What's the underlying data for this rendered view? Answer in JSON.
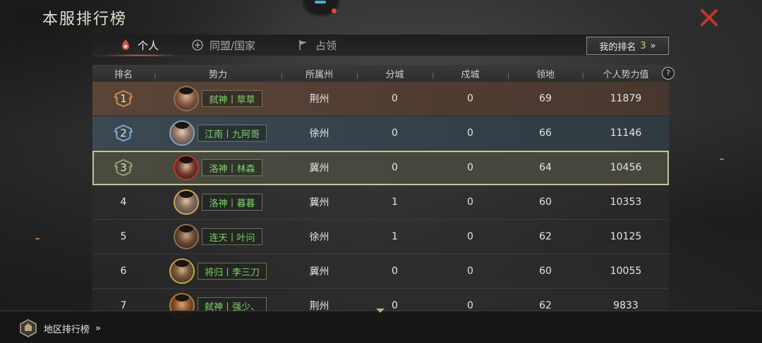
{
  "header": {
    "title": "本服排行榜"
  },
  "tabs": [
    {
      "label": "个人",
      "active": true,
      "icon": "person-flame-icon"
    },
    {
      "label": "同盟/国家",
      "active": false,
      "icon": "alliance-emblem-icon"
    },
    {
      "label": "占领",
      "active": false,
      "icon": "flag-icon"
    }
  ],
  "my_rank": {
    "label": "我的排名",
    "value": "3",
    "arrow": "»"
  },
  "columns": [
    "排名",
    "势力",
    "所属州",
    "分城",
    "戍城",
    "领地",
    "个人势力值"
  ],
  "help_icon": "?",
  "rows": [
    {
      "rank": "1",
      "force": "弑神丨草草",
      "province": "荆州",
      "branch_cities": "0",
      "garrisons": "0",
      "territory": "69",
      "power": "11879"
    },
    {
      "rank": "2",
      "force": "江南丨九阿哥",
      "province": "徐州",
      "branch_cities": "0",
      "garrisons": "0",
      "territory": "66",
      "power": "11146"
    },
    {
      "rank": "3",
      "force": "洛神丨林森",
      "province": "冀州",
      "branch_cities": "0",
      "garrisons": "0",
      "territory": "64",
      "power": "10456"
    },
    {
      "rank": "4",
      "force": "洛神丨暮暮",
      "province": "冀州",
      "branch_cities": "1",
      "garrisons": "0",
      "territory": "60",
      "power": "10353"
    },
    {
      "rank": "5",
      "force": "连天丨叶问",
      "province": "徐州",
      "branch_cities": "1",
      "garrisons": "0",
      "territory": "62",
      "power": "10125"
    },
    {
      "rank": "6",
      "force": "将归丨李三刀",
      "province": "冀州",
      "branch_cities": "0",
      "garrisons": "0",
      "territory": "60",
      "power": "10055"
    },
    {
      "rank": "7",
      "force": "弑神丨强少、",
      "province": "荆州",
      "branch_cities": "0",
      "garrisons": "0",
      "territory": "62",
      "power": "9833"
    }
  ],
  "footer": {
    "region_label": "地区排行榜",
    "arrow": "»"
  },
  "colors": {
    "accent_red": "#d9503f",
    "name_green": "#7fcf6a",
    "rank_highlight": "#e9c766"
  }
}
